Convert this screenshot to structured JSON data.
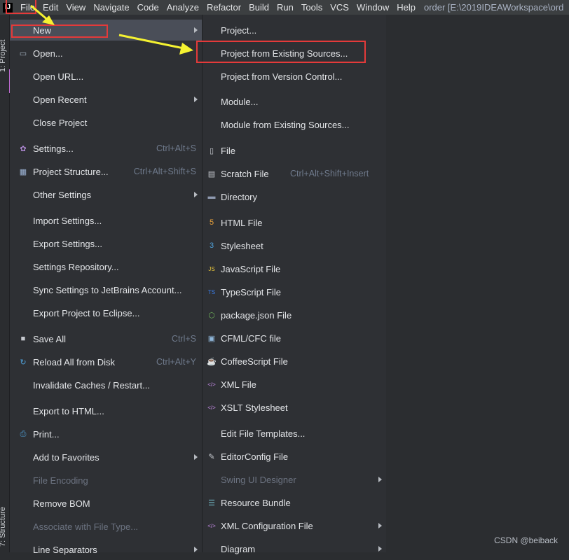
{
  "menubar": {
    "logo": "IJ",
    "items": [
      "File",
      "Edit",
      "View",
      "Navigate",
      "Code",
      "Analyze",
      "Refactor",
      "Build",
      "Run",
      "Tools",
      "VCS",
      "Window",
      "Help"
    ],
    "title": "order [E:\\2019IDEAWorkspace\\ord"
  },
  "toolstrip": {
    "project_label": "1: Project",
    "structure_label": "7: Structure"
  },
  "file_menu": {
    "items": [
      {
        "label": "New",
        "shortcut": "",
        "arrow": true,
        "icon": "",
        "selected": true
      },
      {
        "label": "Open...",
        "shortcut": "",
        "arrow": false,
        "icon": "folder-icon"
      },
      {
        "label": "Open URL...",
        "shortcut": "",
        "arrow": false,
        "icon": ""
      },
      {
        "label": "Open Recent",
        "shortcut": "",
        "arrow": true,
        "icon": ""
      },
      {
        "label": "Close Project",
        "shortcut": "",
        "arrow": false,
        "icon": ""
      },
      {
        "label": "Settings...",
        "shortcut": "Ctrl+Alt+S",
        "arrow": false,
        "icon": "gear-icon"
      },
      {
        "label": "Project Structure...",
        "shortcut": "Ctrl+Alt+Shift+S",
        "arrow": false,
        "icon": "project-structure-icon"
      },
      {
        "label": "Other Settings",
        "shortcut": "",
        "arrow": true,
        "icon": ""
      },
      {
        "label": "Import Settings...",
        "shortcut": "",
        "arrow": false,
        "icon": ""
      },
      {
        "label": "Export Settings...",
        "shortcut": "",
        "arrow": false,
        "icon": ""
      },
      {
        "label": "Settings Repository...",
        "shortcut": "",
        "arrow": false,
        "icon": ""
      },
      {
        "label": "Sync Settings to JetBrains Account...",
        "shortcut": "",
        "arrow": false,
        "icon": ""
      },
      {
        "label": "Export Project to Eclipse...",
        "shortcut": "",
        "arrow": false,
        "icon": ""
      },
      {
        "label": "Save All",
        "shortcut": "Ctrl+S",
        "arrow": false,
        "icon": "save-icon"
      },
      {
        "label": "Reload All from Disk",
        "shortcut": "Ctrl+Alt+Y",
        "arrow": false,
        "icon": "reload-icon"
      },
      {
        "label": "Invalidate Caches / Restart...",
        "shortcut": "",
        "arrow": false,
        "icon": ""
      },
      {
        "label": "Export to HTML...",
        "shortcut": "",
        "arrow": false,
        "icon": ""
      },
      {
        "label": "Print...",
        "shortcut": "",
        "arrow": false,
        "icon": "print-icon"
      },
      {
        "label": "Add to Favorites",
        "shortcut": "",
        "arrow": true,
        "icon": ""
      },
      {
        "label": "File Encoding",
        "shortcut": "",
        "arrow": false,
        "icon": "",
        "disabled": true
      },
      {
        "label": "Remove BOM",
        "shortcut": "",
        "arrow": false,
        "icon": ""
      },
      {
        "label": "Associate with File Type...",
        "shortcut": "",
        "arrow": false,
        "icon": "",
        "disabled": true
      },
      {
        "label": "Line Separators",
        "shortcut": "",
        "arrow": true,
        "icon": ""
      }
    ]
  },
  "new_menu": {
    "items": [
      {
        "label": "Project...",
        "shortcut": "",
        "arrow": false,
        "icon": ""
      },
      {
        "label": "Project from Existing Sources...",
        "shortcut": "",
        "arrow": false,
        "icon": ""
      },
      {
        "label": "Project from Version Control...",
        "shortcut": "",
        "arrow": false,
        "icon": ""
      },
      {
        "label": "Module...",
        "shortcut": "",
        "arrow": false,
        "icon": ""
      },
      {
        "label": "Module from Existing Sources...",
        "shortcut": "",
        "arrow": false,
        "icon": ""
      },
      {
        "label": "File",
        "shortcut": "",
        "arrow": false,
        "icon": "file-icon"
      },
      {
        "label": "Scratch File",
        "shortcut": "Ctrl+Alt+Shift+Insert",
        "arrow": false,
        "icon": "scratch-file-icon"
      },
      {
        "label": "Directory",
        "shortcut": "",
        "arrow": false,
        "icon": "directory-icon"
      },
      {
        "label": "HTML File",
        "shortcut": "",
        "arrow": false,
        "icon": "html-icon"
      },
      {
        "label": "Stylesheet",
        "shortcut": "",
        "arrow": false,
        "icon": "css-icon"
      },
      {
        "label": "JavaScript File",
        "shortcut": "",
        "arrow": false,
        "icon": "javascript-icon"
      },
      {
        "label": "TypeScript File",
        "shortcut": "",
        "arrow": false,
        "icon": "typescript-icon"
      },
      {
        "label": "package.json File",
        "shortcut": "",
        "arrow": false,
        "icon": "nodejs-icon"
      },
      {
        "label": "CFML/CFC file",
        "shortcut": "",
        "arrow": false,
        "icon": "cfml-icon"
      },
      {
        "label": "CoffeeScript File",
        "shortcut": "",
        "arrow": false,
        "icon": "coffeescript-icon"
      },
      {
        "label": "XML File",
        "shortcut": "",
        "arrow": false,
        "icon": "xml-icon"
      },
      {
        "label": "XSLT Stylesheet",
        "shortcut": "",
        "arrow": false,
        "icon": "xslt-icon"
      },
      {
        "label": "Edit File Templates...",
        "shortcut": "",
        "arrow": false,
        "icon": ""
      },
      {
        "label": "EditorConfig File",
        "shortcut": "",
        "arrow": false,
        "icon": "editorconfig-icon"
      },
      {
        "label": "Swing UI Designer",
        "shortcut": "",
        "arrow": true,
        "icon": "",
        "disabled": true
      },
      {
        "label": "Resource Bundle",
        "shortcut": "",
        "arrow": false,
        "icon": "resource-bundle-icon"
      },
      {
        "label": "XML Configuration File",
        "shortcut": "",
        "arrow": true,
        "icon": "xml-config-icon"
      },
      {
        "label": "Diagram",
        "shortcut": "",
        "arrow": true,
        "icon": ""
      }
    ]
  },
  "watermark": "CSDN @beiback",
  "colors": {
    "highlight": "#e43a3a",
    "arrow": "#f5f231",
    "selected": "#4a4e58"
  }
}
